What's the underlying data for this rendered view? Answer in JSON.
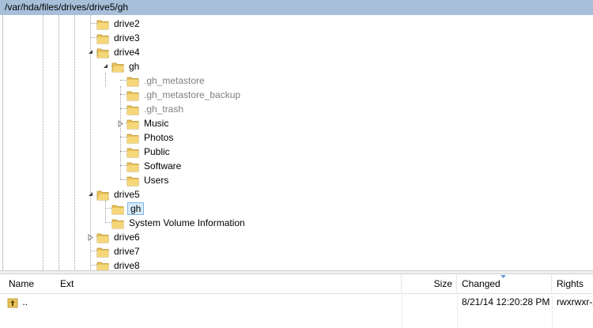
{
  "path_bar": {
    "text": "/var/hda/files/drives/drive5/gh"
  },
  "tree": {
    "drive2": "drive2",
    "drive3": "drive3",
    "drive4": "drive4",
    "gh_drive4": "gh",
    "gh_metastore": ".gh_metastore",
    "gh_metastore_backup": ".gh_metastore_backup",
    "gh_trash": ".gh_trash",
    "music": "Music",
    "photos": "Photos",
    "public": "Public",
    "software": "Software",
    "users": "Users",
    "drive5": "drive5",
    "gh_drive5": "gh",
    "system_volume_information": "System Volume Information",
    "drive6": "drive6",
    "drive7": "drive7",
    "drive8": "drive8"
  },
  "file_list": {
    "columns": {
      "name": "Name",
      "ext": "Ext",
      "size": "Size",
      "changed": "Changed",
      "rights": "Rights"
    },
    "rows": [
      {
        "name": "..",
        "ext": "",
        "size": "",
        "changed": "8/21/14 12:20:28 PM",
        "rights": "rwxrwxr-x"
      }
    ]
  },
  "colors": {
    "path_bar_bg": "#a7bfd9",
    "folder": "#e8c25a",
    "selection": "#d6ebfa",
    "selection_border": "#7eb4ea"
  }
}
